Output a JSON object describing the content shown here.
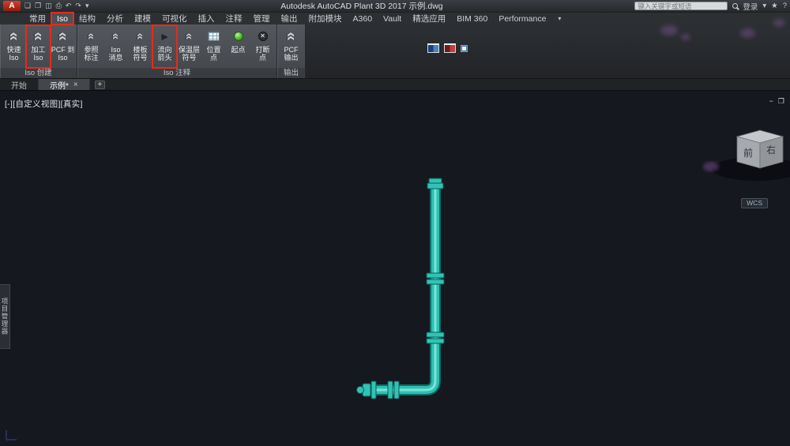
{
  "titlebar": {
    "app_letter": "A",
    "title": "Autodesk AutoCAD Plant 3D 2017   示例.dwg",
    "search_placeholder": "键入关键字或短语",
    "signin": "登录",
    "quick_access": [
      {
        "name": "new-file-icon",
        "glyph": "❏"
      },
      {
        "name": "open-folder-icon",
        "glyph": "❐"
      },
      {
        "name": "save-icon",
        "glyph": "◫"
      },
      {
        "name": "print-icon",
        "glyph": "⎙"
      },
      {
        "name": "undo-icon",
        "glyph": "↶"
      },
      {
        "name": "redo-icon",
        "glyph": "↷"
      },
      {
        "name": "qat-dropdown-icon",
        "glyph": "▾"
      }
    ],
    "signin_dropdown_glyph": "▾",
    "apps_glyph": "★",
    "help_glyph": "?"
  },
  "ribbon": {
    "tabs": [
      {
        "label": "常用",
        "name": "tab-home"
      },
      {
        "label": "Iso",
        "name": "tab-iso",
        "state": "active red-box"
      },
      {
        "label": "结构",
        "name": "tab-structure"
      },
      {
        "label": "分析",
        "name": "tab-analysis"
      },
      {
        "label": "建模",
        "name": "tab-modeling"
      },
      {
        "label": "可视化",
        "name": "tab-visualization"
      },
      {
        "label": "插入",
        "name": "tab-insert"
      },
      {
        "label": "注释",
        "name": "tab-annotate"
      },
      {
        "label": "管理",
        "name": "tab-manage"
      },
      {
        "label": "输出",
        "name": "tab-output"
      },
      {
        "label": "附加模块",
        "name": "tab-addins"
      },
      {
        "label": "A360",
        "name": "tab-a360"
      },
      {
        "label": "Vault",
        "name": "tab-vault"
      },
      {
        "label": "精选应用",
        "name": "tab-featured-apps"
      },
      {
        "label": "BIM 360",
        "name": "tab-bim360"
      },
      {
        "label": "Performance",
        "name": "tab-performance"
      }
    ],
    "display_toggle_glyph": "▾",
    "panels": [
      {
        "label": "Iso 创建",
        "buttons": [
          {
            "name": "quick-iso-button",
            "icon": "icon-chevrons lg",
            "icon_name": "chevrons-icon",
            "top": "快速",
            "bottom": "Iso"
          },
          {
            "name": "machining-iso-button",
            "icon": "icon-chevrons lg",
            "icon_name": "chevrons-icon",
            "top": "加工",
            "bottom": "Iso",
            "state": "red-box"
          },
          {
            "name": "pcf-to-iso-button",
            "icon": "icon-chevrons lg",
            "icon_name": "chevrons-icon",
            "top": "PCF 到",
            "bottom": "Iso"
          }
        ]
      },
      {
        "label": "Iso 注释",
        "buttons": [
          {
            "name": "reference-annotation-button",
            "icon": "icon-chevrons sm",
            "icon_name": "chevrons-icon",
            "top": "参照",
            "bottom": "标注"
          },
          {
            "name": "iso-message-button",
            "icon": "icon-chevrons sm",
            "icon_name": "chevrons-icon",
            "top": "Iso",
            "bottom": "消息"
          },
          {
            "name": "floor-symbol-button",
            "icon": "icon-chevrons sm",
            "icon_name": "chevrons-icon",
            "top": "楼板",
            "bottom": "符号"
          },
          {
            "name": "flow-arrow-button",
            "icon": "icon-play",
            "icon_name": "flow-arrow-icon",
            "top": "流向",
            "bottom": "箭头",
            "state": "red-box"
          },
          {
            "name": "insulation-symbol-button",
            "icon": "icon-chevrons sm",
            "icon_name": "chevrons-icon",
            "top": "保温层",
            "bottom": "符号"
          },
          {
            "name": "location-point-button",
            "icon": "icon-grid",
            "icon_name": "grid-icon",
            "top": "位置",
            "bottom": "点"
          },
          {
            "name": "start-point-button",
            "icon": "icon-green",
            "icon_name": "green-point-icon",
            "top": "起点",
            "bottom": ""
          },
          {
            "name": "break-point-button",
            "icon": "icon-break",
            "icon_name": "break-point-icon",
            "top": "打断",
            "bottom": "点"
          }
        ]
      },
      {
        "label": "输出",
        "buttons": [
          {
            "name": "pcf-output-button",
            "icon": "icon-chevrons lg",
            "icon_name": "chevrons-icon",
            "top": "PCF",
            "bottom": "输出"
          }
        ]
      }
    ]
  },
  "file_tabs": {
    "tabs": [
      {
        "label": "开始",
        "name": "file-tab-start",
        "state": ""
      },
      {
        "label": "示例*",
        "name": "file-tab-drawing",
        "state": "active",
        "close": "×"
      }
    ],
    "new_tab_glyph": "+"
  },
  "viewport": {
    "controls": "[-][自定义视图][真实]",
    "min_glyph": "−",
    "restore_glyph": "❐",
    "viewcube": {
      "front": "前",
      "right": "右"
    },
    "wcs": "WCS",
    "project_manager": "项目管理器"
  },
  "colors": {
    "pipe": "#2cc0b2",
    "highlight_red": "#e8291c"
  }
}
